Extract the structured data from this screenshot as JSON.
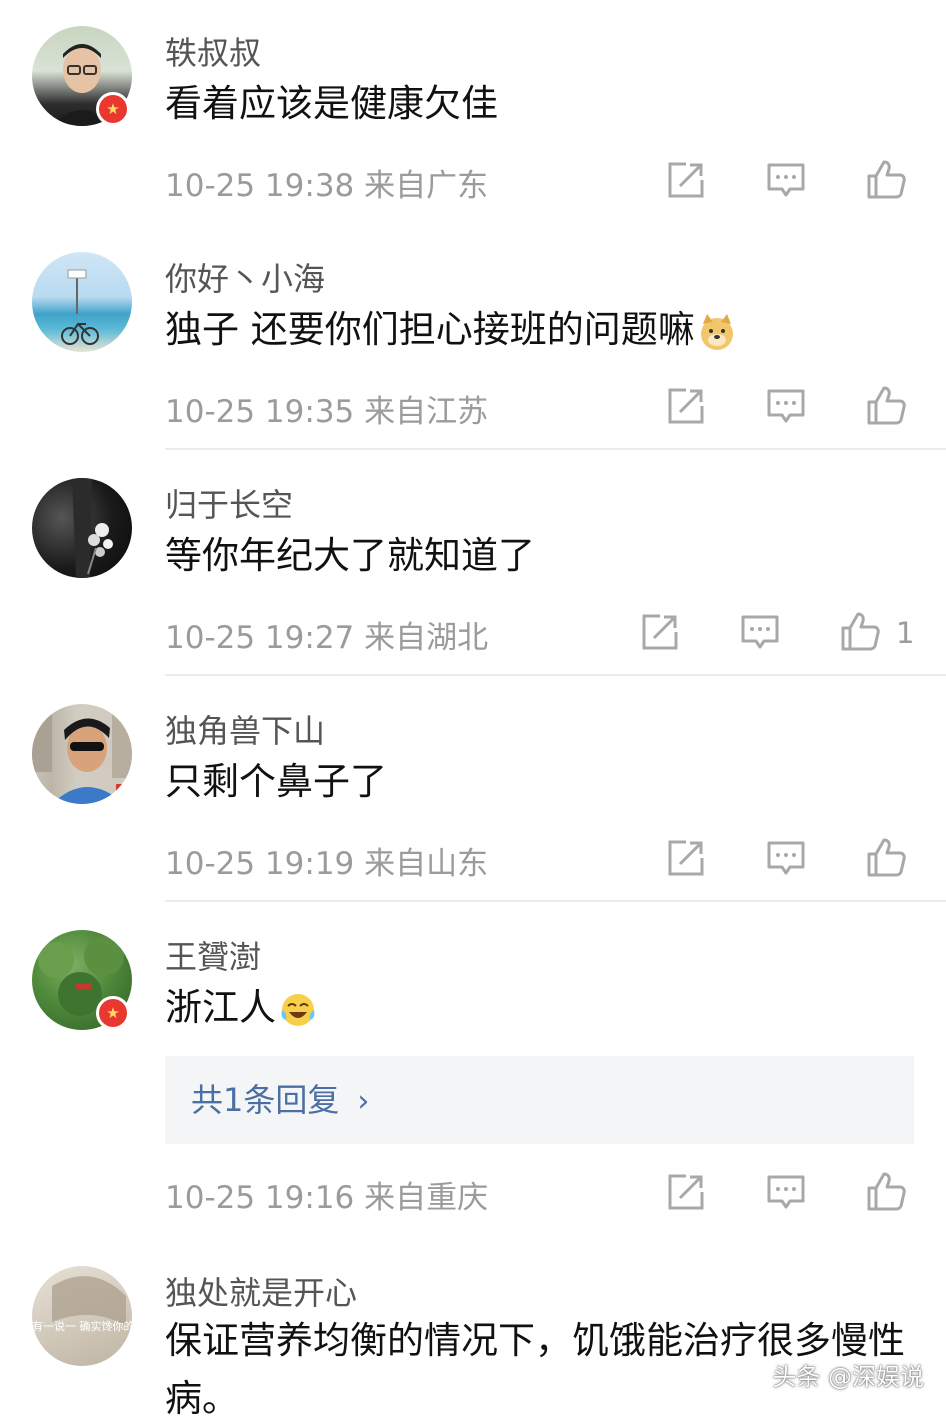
{
  "comments": [
    {
      "name": "轶叔叔",
      "text": "看着应该是健康欠佳",
      "time": "10-25 19:38",
      "location": "来自广东",
      "likes": ""
    },
    {
      "name": "你好丶小海",
      "text": "独子 还要你们担心接班的问题嘛",
      "time": "10-25 19:35",
      "location": "来自江苏",
      "likes": ""
    },
    {
      "name": "归于长空",
      "text": "等你年纪大了就知道了",
      "time": "10-25 19:27",
      "location": "来自湖北",
      "likes": "1"
    },
    {
      "name": "独角兽下山",
      "text": "只剩个鼻子了",
      "time": "10-25 19:19",
      "location": "来自山东",
      "likes": ""
    },
    {
      "name": "王贇澍",
      "text": "浙江人",
      "time": "10-25 19:16",
      "location": "来自重庆",
      "likes": "",
      "reply_label": "共1条回复"
    },
    {
      "name": "独处就是开心",
      "text": "保证营养均衡的情况下，饥饿能治疗很多慢性病。",
      "avatar_text": "有一说一 确实馋你的身"
    }
  ],
  "icons": {
    "share": "share-icon",
    "comment": "comment-icon",
    "like": "thumbs-up-icon",
    "badge": "verified-badge-icon"
  },
  "colors": {
    "meta": "#9b9b9b",
    "reply_link": "#4c6fa3",
    "badge": "#e8382f"
  },
  "watermark": "头条 @深娱说"
}
